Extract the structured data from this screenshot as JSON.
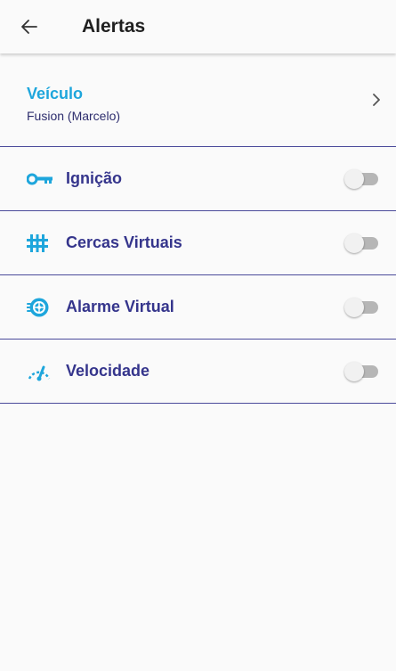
{
  "header": {
    "title": "Alertas",
    "back_icon": "arrow-left-icon"
  },
  "vehicle": {
    "label": "Veículo",
    "value": "Fusion (Marcelo)",
    "chevron_icon": "chevron-right-icon"
  },
  "alerts": [
    {
      "label": "Ignição",
      "icon": "key-icon",
      "enabled": false
    },
    {
      "label": "Cercas Virtuais",
      "icon": "fence-icon",
      "enabled": false
    },
    {
      "label": "Alarme Virtual",
      "icon": "alarm-wheel-icon",
      "enabled": false
    },
    {
      "label": "Velocidade",
      "icon": "speedometer-icon",
      "enabled": false
    }
  ],
  "colors": {
    "accent": "#1ea6dc",
    "primary": "#35358c",
    "divider": "#4a4a9a"
  }
}
